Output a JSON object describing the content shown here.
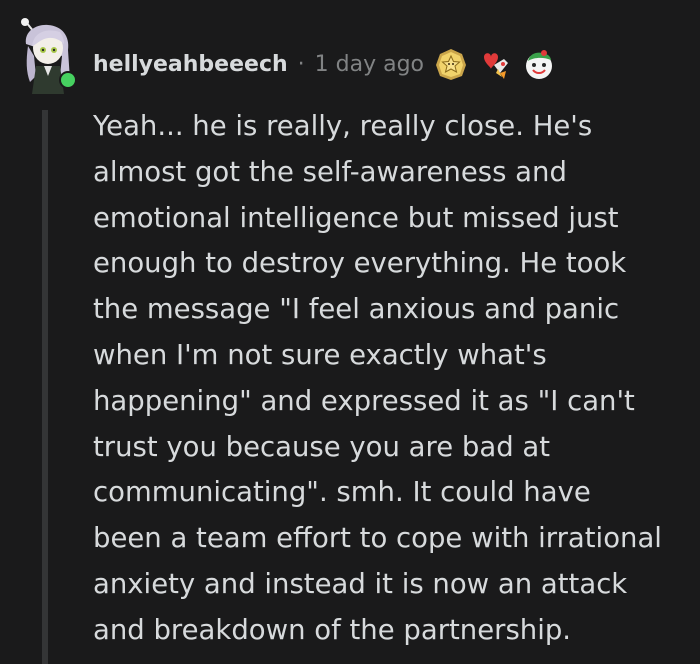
{
  "comment": {
    "username": "hellyeahbeeech",
    "separator": "·",
    "timestamp": "1 day ago",
    "awards": [
      {
        "icon": "gold-star-award-icon"
      },
      {
        "icon": "rocket-heart-award-icon"
      },
      {
        "icon": "wholesome-face-award-icon"
      }
    ],
    "avatar": {
      "icon": "avatar-icon",
      "online_status_color": "#46d160"
    },
    "body_lines": [
      "Yeah... he is really, really close. He's",
      "almost got the self-awareness and",
      "emotional intelligence but missed just",
      "enough to destroy everything. He took",
      "the message \"I feel anxious and panic",
      "when I'm not sure exactly what's",
      "happening\" and expressed it as \"I can't",
      "trust you because you are bad at",
      "communicating\". smh. It could have",
      "been a team effort to cope with irrational",
      "anxiety and instead it is now an attack",
      "and breakdown of the partnership."
    ]
  },
  "colors": {
    "background": "#1a1a1b",
    "text": "#d7dadc",
    "meta": "#818384",
    "thread_line": "#343536"
  }
}
